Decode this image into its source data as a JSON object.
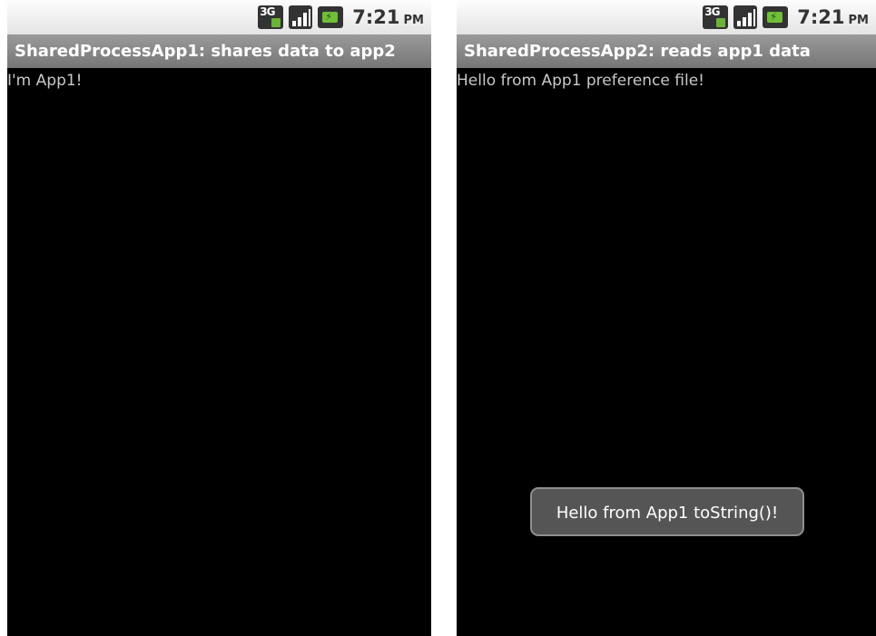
{
  "screens": [
    {
      "status_bar": {
        "network_icon": "3g-data-icon",
        "network_label": "3G",
        "signal_icon": "signal-strength-icon",
        "battery_icon": "battery-charging-icon",
        "time": "7:21",
        "ampm": "PM"
      },
      "title": "SharedProcessApp1: shares data to app2",
      "body_text": "I'm App1!"
    },
    {
      "status_bar": {
        "network_icon": "3g-data-icon",
        "network_label": "3G",
        "signal_icon": "signal-strength-icon",
        "battery_icon": "battery-charging-icon",
        "time": "7:21",
        "ampm": "PM"
      },
      "title": "SharedProcessApp2: reads app1 data",
      "body_text": "Hello from App1 preference file!",
      "toast": "Hello from App1 toString()!"
    }
  ],
  "colors": {
    "title_bar": "#8a8a8a",
    "content_bg": "#000000",
    "toast_bg": "#555555"
  }
}
